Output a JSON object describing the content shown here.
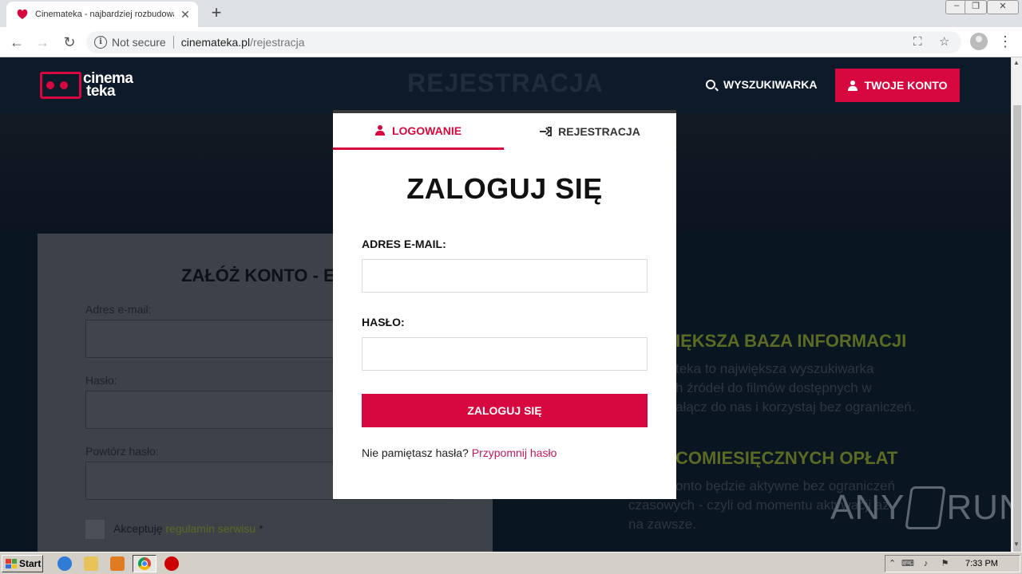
{
  "browser": {
    "tab_title": "Cinemateka - najbardziej rozbudowa",
    "security_label": "Not secure",
    "url_host": "cinemateka.pl",
    "url_path": "/rejestracja"
  },
  "site": {
    "logo_line1": "cinema",
    "logo_line2": "teka",
    "page_title": "REJESTRACJA",
    "search_label": "WYSZUKIWARKA",
    "account_label": "TWOJE KONTO",
    "accent_color": "#d6083f"
  },
  "register_form": {
    "title": "ZAŁÓŻ KONTO - ETAP",
    "email_label": "Adres e-mail:",
    "password_label": "Hasło:",
    "repeat_password_label": "Powtórz hasło:",
    "accept_text": "Akceptuję",
    "terms_link": "regulamin serwisu",
    "required_mark": " *"
  },
  "features": [
    {
      "title": "IĘKSZA BAZA INFORMACJI",
      "lines": [
        "teka to największa wyszukiwarka",
        "h źródeł do filmów dostępnych w",
        "ałącz do nas i korzystaj bez ograniczeń."
      ]
    },
    {
      "title": "COMIESIĘCZNYCH OPŁAT",
      "lines": [
        "onto będzie aktywne bez ograniczeń",
        "czasowych - czyli od momentu aktywacji aż",
        "na zawsze."
      ]
    }
  ],
  "login_modal": {
    "tab_login": "LOGOWANIE",
    "tab_register": "REJESTRACJA",
    "heading": "ZALOGUJ SIĘ",
    "email_label": "ADRES E-MAIL:",
    "email_value": "",
    "password_label": "HASŁO:",
    "password_value": "",
    "submit_label": "ZALOGUJ SIĘ",
    "forgot_text": "Nie pamiętasz hasła?",
    "forgot_link": "Przypomnij hasło"
  },
  "watermark": {
    "left": "ANY",
    "right": "RUN"
  },
  "taskbar": {
    "start_label": "Start",
    "clock": "7:33 PM"
  }
}
